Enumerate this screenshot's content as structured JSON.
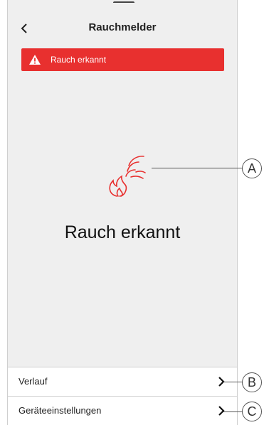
{
  "header": {
    "title": "Rauchmelder"
  },
  "alert": {
    "text": "Rauch erkannt"
  },
  "status": {
    "text": "Rauch erkannt"
  },
  "rows": [
    {
      "label": "Verlauf"
    },
    {
      "label": "Geräteeinstellungen"
    }
  ],
  "callouts": {
    "a": "A",
    "b": "B",
    "c": "C"
  },
  "colors": {
    "alert": "#e8302f",
    "background": "#efefef"
  },
  "icons": {
    "back": "chevron-left-icon",
    "alert": "warning-icon",
    "status": "smoke-fire-icon",
    "row": "chevron-right-icon"
  }
}
